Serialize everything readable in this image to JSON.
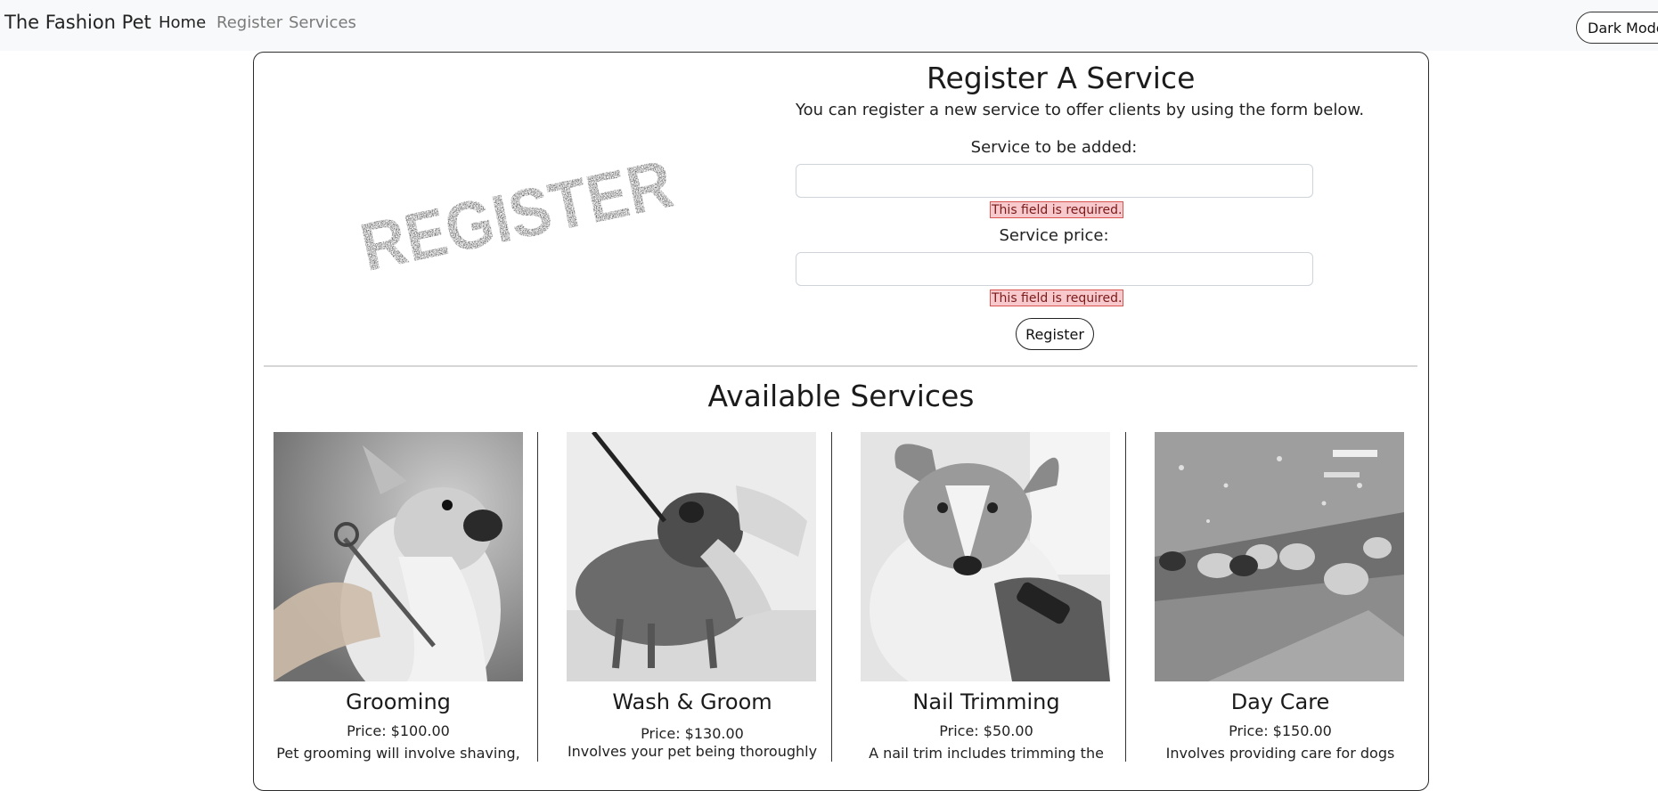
{
  "navbar": {
    "brand": "The Fashion Pet",
    "links": [
      {
        "label": "Home",
        "active": true
      },
      {
        "label": "Register",
        "active": false
      },
      {
        "label": "Services",
        "active": false
      }
    ],
    "dark_mode_label": "Dark Mode"
  },
  "register": {
    "image_text": "REGISTER",
    "title": "Register A Service",
    "description": "You can register a new service to offer clients by using the form below.",
    "service_label": "Service to be added:",
    "service_value": "",
    "service_error": "This field is required.",
    "price_label": "Service price:",
    "price_value": "",
    "price_error": "This field is required.",
    "submit_label": "Register"
  },
  "services_section": {
    "title": "Available Services",
    "items": [
      {
        "name": "Grooming",
        "price": "Price: $100.00",
        "description": "Pet grooming will involve shaving,"
      },
      {
        "name": "Wash & Groom",
        "price": "Price: $130.00",
        "description": "Involves your pet being thoroughly"
      },
      {
        "name": "Nail Trimming",
        "price": "Price: $50.00",
        "description": "A nail trim includes trimming the"
      },
      {
        "name": "Day Care",
        "price": "Price: $150.00",
        "description": "Involves providing care for dogs"
      }
    ]
  },
  "colors": {
    "navbar_bg": "#f8f9fa",
    "error_bg": "#f8c9cc",
    "error_border": "#d9534f",
    "card_border": "#2b2b2b"
  }
}
